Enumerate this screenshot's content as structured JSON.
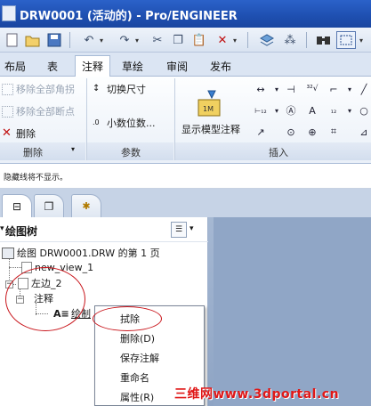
{
  "window": {
    "title": "DRW0001 (活动的) - Pro/ENGINEER"
  },
  "quick_access": {
    "icons": [
      "new-icon",
      "open-icon",
      "save-icon",
      "undo-icon",
      "redo-icon",
      "cut-icon",
      "copy-icon",
      "paste-icon",
      "delete-icon",
      "layers-icon",
      "regenerate-icon",
      "find-icon",
      "select-box-icon"
    ]
  },
  "ribbon_tabs": [
    "布局",
    "表",
    "注释",
    "草绘",
    "审阅",
    "发布"
  ],
  "active_tab": "注释",
  "ribbon": {
    "delete_group": {
      "items": [
        "移除全部角拐",
        "移除全部断点",
        "删除"
      ],
      "label": "删除"
    },
    "params_group": {
      "items": [
        "切换尺寸",
        "小数位数..."
      ],
      "label": "参数"
    },
    "insert_group": {
      "show_model_annotations": "显示模型注释",
      "label": "插入"
    }
  },
  "message_line": "隐藏线将不显示。",
  "navigator": {
    "panel_title": "绘图树",
    "tree": [
      {
        "label": "绘图 DRW0001.DRW 的第 1 页"
      },
      {
        "label": "new_view_1"
      },
      {
        "label": "左边_2"
      },
      {
        "label": "注释"
      },
      {
        "label": "绘制"
      }
    ]
  },
  "context_menu": {
    "items": [
      {
        "label": "拭除"
      },
      {
        "label": "删除(D)"
      },
      {
        "label": "保存注解"
      },
      {
        "label": "重命名"
      },
      {
        "label": "属性(R)"
      }
    ]
  },
  "watermark": "三维网www.3dportal.cn",
  "colors": {
    "title_bar": "#1e4fb0",
    "graphics_bg": "#9bb0cd",
    "annotation_circle": "#c8141a",
    "watermark": "#e01818"
  }
}
